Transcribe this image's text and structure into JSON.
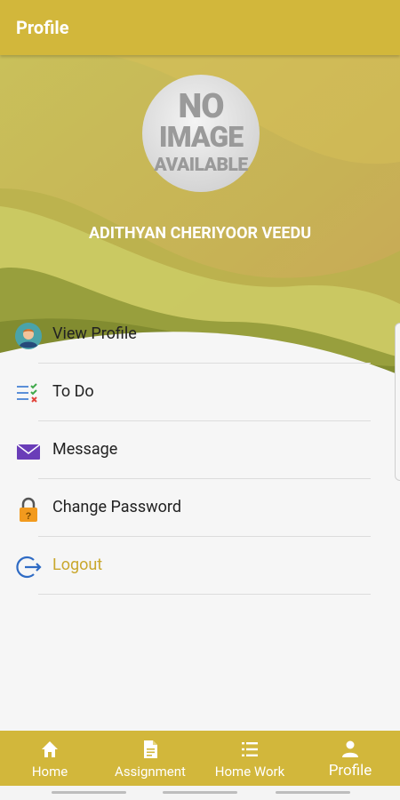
{
  "appbar": {
    "title": "Profile"
  },
  "avatar": {
    "line1": "NO",
    "line2": "IMAGE",
    "line3": "AVAILABLE"
  },
  "user": {
    "name": "ADITHYAN CHERIYOOR VEEDU"
  },
  "menu": [
    {
      "label": "View Profile",
      "icon": "user-avatar-icon"
    },
    {
      "label": "To Do",
      "icon": "checklist-icon"
    },
    {
      "label": "Message",
      "icon": "envelope-icon"
    },
    {
      "label": "Change Password",
      "icon": "lock-icon"
    },
    {
      "label": "Logout",
      "icon": "logout-icon"
    }
  ],
  "bottom_nav": [
    {
      "label": "Home",
      "icon": "home-icon"
    },
    {
      "label": "Assignment",
      "icon": "document-icon"
    },
    {
      "label": "Home Work",
      "icon": "list-icon"
    },
    {
      "label": "Profile",
      "icon": "person-icon",
      "active": true
    }
  ],
  "colors": {
    "primary": "#d2b73b",
    "accent_text": "#c9a72c"
  }
}
